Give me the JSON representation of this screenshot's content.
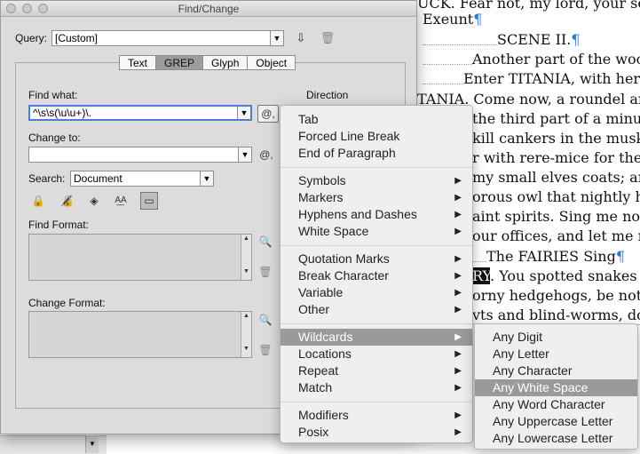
{
  "document": {
    "lines": [
      {
        "text": "UCK. Fear not, my lord, your serv",
        "pilcrow": false
      },
      {
        "text": "Exeunt",
        "pilcrow": true
      },
      {
        "text": "SCENE II.",
        "pilcrow": true
      },
      {
        "text": "Another part of the wood",
        "pilcrow": false
      },
      {
        "text": "Enter TITANIA, with her t",
        "pilcrow": false
      },
      {
        "text": "TANIA. Come now, a roundel an",
        "pilcrow": false
      },
      {
        "text": "the third part of a minu",
        "pilcrow": false
      },
      {
        "text": "kill cankers in the musk-",
        "pilcrow": false
      },
      {
        "text": "r with rere-mice for thei",
        "pilcrow": false
      },
      {
        "text": "my small elves coats; and",
        "pilcrow": false
      },
      {
        "text": "orous owl that nightly ho",
        "pilcrow": false
      },
      {
        "text": "aint spirits. Sing me now",
        "pilcrow": false
      },
      {
        "text": "our offices, and let me re",
        "pilcrow": false
      },
      {
        "text": "The FAIRIES Sing",
        "pilcrow": true
      },
      {
        "text": ". You spotted snakes w",
        "pilcrow": false,
        "highlight": "RY"
      },
      {
        "text": "orny hedgehogs, be not se",
        "pilcrow": false
      },
      {
        "text": "vts and blind-worms, do",
        "pilcrow": false
      }
    ]
  },
  "dialog": {
    "title": "Find/Change",
    "query_label": "Query:",
    "query_value": "[Custom]",
    "tabs": [
      "Text",
      "GREP",
      "Glyph",
      "Object"
    ],
    "active_tab": "GREP",
    "find_what_label": "Find what:",
    "find_what_value": "^\\s\\s(\\u\\u+)\\.",
    "change_to_label": "Change to:",
    "change_to_value": "",
    "direction_label": "Direction",
    "search_label": "Search:",
    "search_value": "Document",
    "find_format_label": "Find Format:",
    "change_format_label": "Change Format:",
    "special_char_symbol": "@,"
  },
  "menu": {
    "groups": [
      [
        "Tab",
        "Forced Line Break",
        "End of Paragraph"
      ],
      [
        "Symbols",
        "Markers",
        "Hyphens and Dashes",
        "White Space"
      ],
      [
        "Quotation Marks",
        "Break Character",
        "Variable",
        "Other"
      ],
      [
        "Wildcards",
        "Locations",
        "Repeat",
        "Match"
      ],
      [
        "Modifiers",
        "Posix"
      ]
    ],
    "submenu_flags": [
      [
        false,
        false,
        false
      ],
      [
        true,
        true,
        true,
        true
      ],
      [
        true,
        true,
        true,
        true
      ],
      [
        true,
        true,
        true,
        true
      ],
      [
        true,
        true
      ]
    ],
    "selected": "Wildcards"
  },
  "submenu": {
    "items": [
      "Any Digit",
      "Any Letter",
      "Any Character",
      "Any White Space",
      "Any Word Character",
      "Any Uppercase Letter",
      "Any Lowercase Letter"
    ],
    "selected": "Any White Space"
  }
}
